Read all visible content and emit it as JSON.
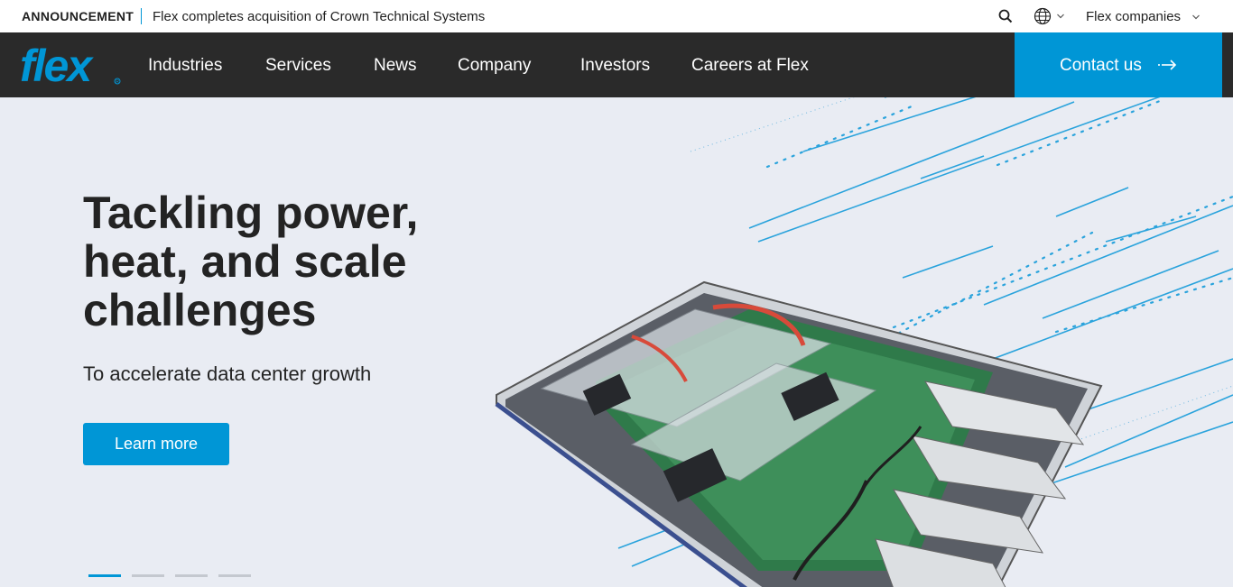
{
  "announcement": {
    "tag": "ANNOUNCEMENT",
    "text": "Flex completes acquisition of Crown Technical Systems"
  },
  "utility": {
    "search_icon": "search-icon",
    "language_icon": "globe-icon",
    "companies_label": "Flex companies"
  },
  "nav": {
    "logo_text": "flex",
    "items": [
      {
        "label": "Industries"
      },
      {
        "label": "Services"
      },
      {
        "label": "News"
      },
      {
        "label": "Company"
      },
      {
        "label": "Investors"
      },
      {
        "label": "Careers at Flex"
      }
    ],
    "contact_label": "Contact us"
  },
  "hero": {
    "title": "Tackling power, heat, and scale challenges",
    "subtitle": "To accelerate data center growth",
    "cta_label": "Learn more",
    "slide_count": 4,
    "active_slide": 1
  },
  "colors": {
    "brand_blue": "#0096d6",
    "nav_bg": "#2a2a2a",
    "hero_bg": "#e9ecf3"
  }
}
